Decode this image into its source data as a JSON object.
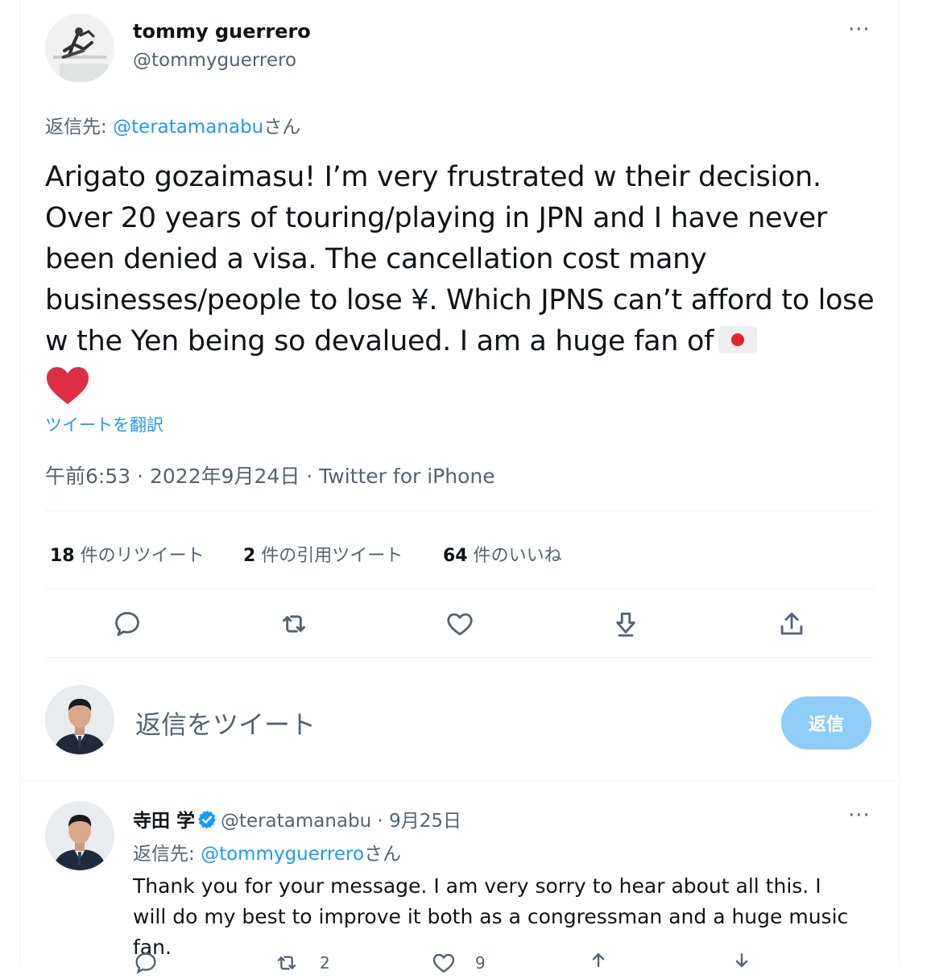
{
  "tweet": {
    "author_name": "tommy guerrero",
    "author_handle": "@tommyguerrero",
    "reply_prefix": "返信先: ",
    "reply_to": "@teratamanabu",
    "reply_suffix": "さん",
    "text": "Arigato gozaimasu! I’m very frustrated w their decision. Over 20 years of touring/playing in JPN and I have never been denied a visa. The cancellation cost many businesses/people to lose ¥. Which JPNS can’t afford to lose w the Yen being so devalued. I am a huge fan of",
    "emoji_heart": "❤",
    "translate_label": "ツイートを翻訳",
    "timestamp": "午前6:53 · 2022年9月24日 · Twitter for iPhone",
    "more_label": "···"
  },
  "stats": {
    "retweets_count": "18",
    "retweets_label": " 件のリツイート",
    "quotes_count": "2",
    "quotes_label": " 件の引用ツイート",
    "likes_count": "64",
    "likes_label": " 件のいいね"
  },
  "actions": [
    "reply-icon",
    "retweet-icon",
    "like-icon",
    "bookmark-icon",
    "share-icon"
  ],
  "compose": {
    "placeholder": "返信をツイート",
    "button_label": "返信"
  },
  "reply": {
    "author_name": "寺田 学",
    "author_handle": "@teratamanabu",
    "date": " · 9月25日",
    "reply_prefix": "返信先: ",
    "reply_to": "@tommyguerrero",
    "reply_suffix": "さん",
    "text": "Thank you for your message. I am very sorry to hear about all this. I will do my best to improve it both as a congressman and a huge music fan.",
    "retweet_count": "2",
    "like_count": "9",
    "more_label": "···"
  },
  "colors": {
    "accent": "#1d9bf0",
    "muted": "#536471",
    "reply_button_disabled": "#8ecdf7"
  }
}
